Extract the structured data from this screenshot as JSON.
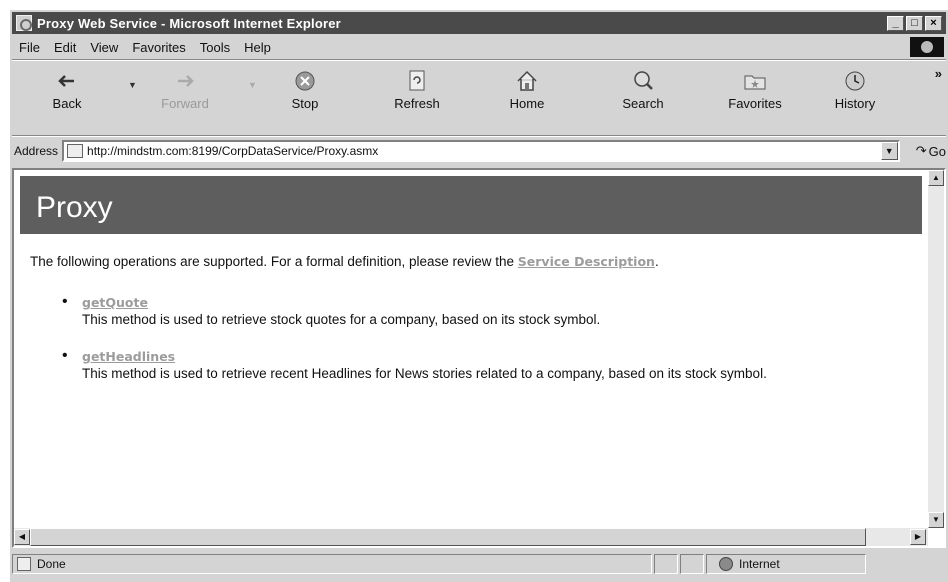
{
  "window": {
    "title": "Proxy Web Service - Microsoft Internet Explorer",
    "controls": {
      "minimize": "_",
      "maximize": "□",
      "close": "×"
    }
  },
  "menu": {
    "items": [
      {
        "label": "File"
      },
      {
        "label": "Edit"
      },
      {
        "label": "View"
      },
      {
        "label": "Favorites"
      },
      {
        "label": "Tools"
      },
      {
        "label": "Help"
      }
    ]
  },
  "toolbar": {
    "back": "Back",
    "forward": "Forward",
    "stop": "Stop",
    "refresh": "Refresh",
    "home": "Home",
    "search": "Search",
    "favorites": "Favorites",
    "history": "History",
    "more": "»"
  },
  "address": {
    "label": "Address",
    "url": "http://mindstm.com:8199/CorpDataService/Proxy.asmx",
    "go": "Go"
  },
  "page": {
    "heading": "Proxy",
    "intro_prefix": "The following operations are supported. For a formal definition, please review the ",
    "service_description_link": "Service Description",
    "intro_suffix": ".",
    "operations": [
      {
        "name": "getQuote",
        "description": "This method is used to retrieve stock quotes for a company, based on its stock symbol."
      },
      {
        "name": "getHeadlines",
        "description": "This method is used to retrieve recent Headlines for News stories related to a company, based on its stock symbol."
      }
    ]
  },
  "status": {
    "text": "Done",
    "zone": "Internet"
  },
  "colors": {
    "heading_band": "#5e5e5e",
    "titlebar": "#4a4a4a",
    "link": "#9c9c9c"
  }
}
